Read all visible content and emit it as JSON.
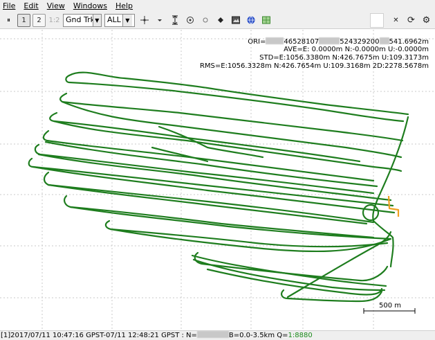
{
  "menu": [
    "File",
    "Edit",
    "View",
    "Windows",
    "Help"
  ],
  "toolbar": {
    "pause_glyph": "⏸",
    "btn1": "1",
    "btn2": "2",
    "btn12": "1:2",
    "plot_type": "Gnd Trk",
    "solution_filter": "ALL",
    "close_glyph": "✕",
    "refresh_glyph": "⟳",
    "settings_glyph": "⚙"
  },
  "stats": {
    "ori_prefix": "ORI=",
    "ori_a": "46528107",
    "ori_b": "524329200",
    "ori_c": "541.6962m",
    "ave": "AVE=E: 0.0000m N:-0.0000m U:-0.0000m",
    "std": "STD=E:1056.3380m N:426.7675m U:109.3173m",
    "rms": "RMS=E:1056.3328m N:426.7654m U:109.3168m 2D:2278.5678m"
  },
  "scale": {
    "label": "500 m"
  },
  "status": {
    "text": "[1]2017/07/11 10:47:16 GPST-07/11 12:48:21 GPST : N=",
    "text2": "B=0.0-3.5km Q=",
    "q_value": "1:8880"
  },
  "colors": {
    "track": "#1e7d1e",
    "float": "#f0a020",
    "grid": "#c8c8c8"
  }
}
